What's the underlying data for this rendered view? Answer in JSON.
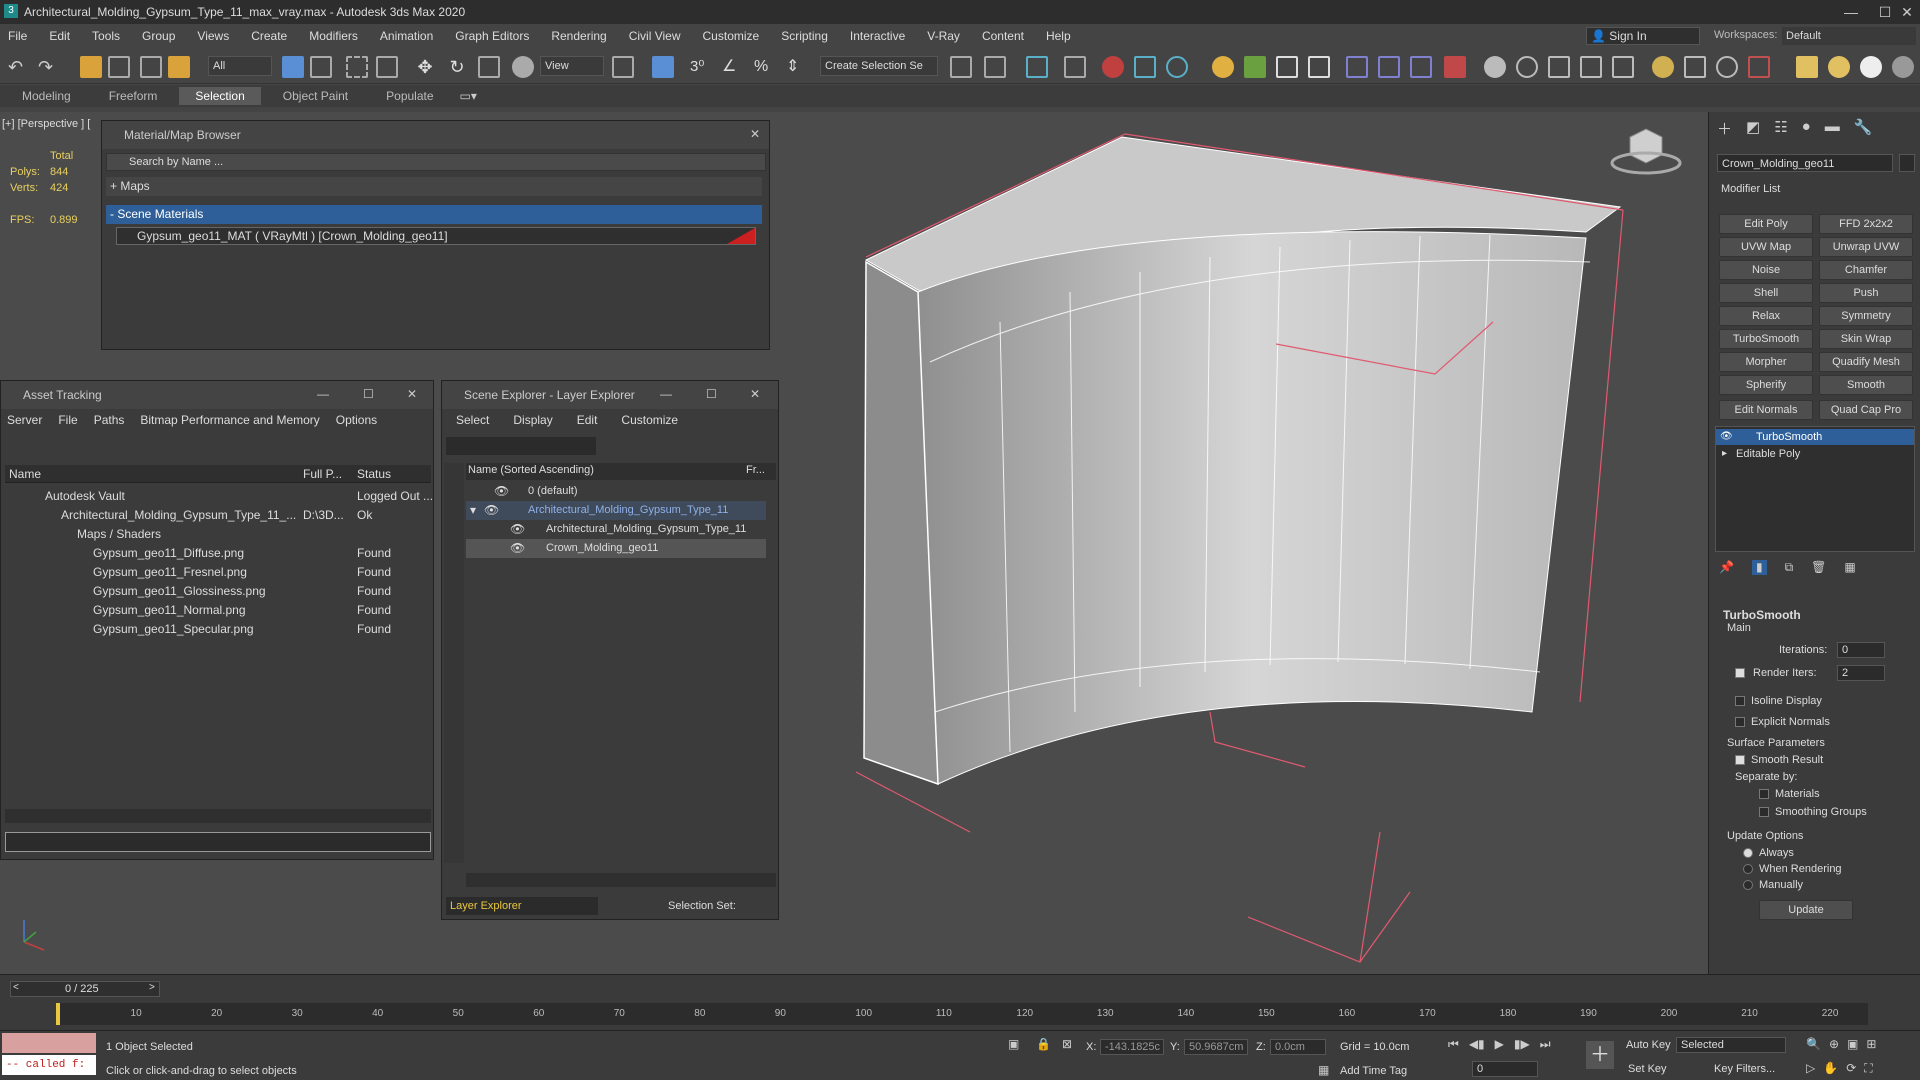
{
  "window": {
    "title": "Architectural_Molding_Gypsum_Type_11_max_vray.max - Autodesk 3ds Max 2020",
    "minimize": "—",
    "maximize": "☐",
    "close": "✕"
  },
  "menu": [
    "File",
    "Edit",
    "Tools",
    "Group",
    "Views",
    "Create",
    "Modifiers",
    "Animation",
    "Graph Editors",
    "Rendering",
    "Civil View",
    "Customize",
    "Scripting",
    "Interactive",
    "V-Ray",
    "Content",
    "Help"
  ],
  "signin": "Sign In",
  "workspaces": {
    "label": "Workspaces:",
    "value": "Default"
  },
  "toolbar": {
    "filter": "All",
    "view": "View",
    "selection_set": "Create Selection Se"
  },
  "ribbon": [
    "Modeling",
    "Freeform",
    "Selection",
    "Object Paint",
    "Populate"
  ],
  "viewport": {
    "label": "[+] [Perspective ] [",
    "stats": {
      "total": "Total",
      "polys_label": "Polys:",
      "polys": "844",
      "verts_label": "Verts:",
      "verts": "424",
      "fps_label": "FPS:",
      "fps": "0.899"
    }
  },
  "material_browser": {
    "title": "Material/Map Browser",
    "search": "Search by Name ...",
    "maps": "+ Maps",
    "scene_materials": "- Scene Materials",
    "item": "Gypsum_geo11_MAT ( VRayMtl ) [Crown_Molding_geo11]"
  },
  "asset_tracking": {
    "title": "Asset Tracking",
    "menu": [
      "Server",
      "File",
      "Paths",
      "Bitmap Performance and Memory",
      "Options"
    ],
    "columns": [
      "Name",
      "Full P...",
      "Status"
    ],
    "rows": [
      {
        "name": "Autodesk Vault",
        "path": "",
        "status": "Logged Out ..."
      },
      {
        "name": "Architectural_Molding_Gypsum_Type_11_...",
        "path": "D:\\3D...",
        "status": "Ok"
      },
      {
        "name": "Maps / Shaders",
        "path": "",
        "status": ""
      },
      {
        "name": "Gypsum_geo11_Diffuse.png",
        "path": "",
        "status": "Found"
      },
      {
        "name": "Gypsum_geo11_Fresnel.png",
        "path": "",
        "status": "Found"
      },
      {
        "name": "Gypsum_geo11_Glossiness.png",
        "path": "",
        "status": "Found"
      },
      {
        "name": "Gypsum_geo11_Normal.png",
        "path": "",
        "status": "Found"
      },
      {
        "name": "Gypsum_geo11_Specular.png",
        "path": "",
        "status": "Found"
      }
    ]
  },
  "scene_explorer": {
    "title": "Scene Explorer - Layer Explorer",
    "menu": [
      "Select",
      "Display",
      "Edit",
      "Customize"
    ],
    "col_name": "Name (Sorted Ascending)",
    "col_fr": "Fr...",
    "rows": [
      "0 (default)",
      "Architectural_Molding_Gypsum_Type_11",
      "Architectural_Molding_Gypsum_Type_11",
      "Crown_Molding_geo11"
    ],
    "footer_mode": "Layer Explorer",
    "footer_sel": "Selection Set:"
  },
  "command_panel": {
    "object_name": "Crown_Molding_geo11",
    "modifier_list": "Modifier List",
    "buttons": [
      "Edit Poly",
      "FFD 2x2x2",
      "UVW Map",
      "Unwrap UVW",
      "Noise",
      "Chamfer",
      "Shell",
      "Push",
      "Relax",
      "Symmetry",
      "TurboSmooth",
      "Skin Wrap",
      "Morpher",
      "Quadify Mesh",
      "Spherify",
      "Smooth",
      "Edit Normals",
      "Quad Cap Pro"
    ],
    "stack": [
      "TurboSmooth",
      "Editable Poly"
    ],
    "rollout": {
      "title": "TurboSmooth",
      "main": "Main",
      "iterations_label": "Iterations:",
      "iterations": "0",
      "render_iters_label": "Render Iters:",
      "render_iters": "2",
      "isoline": "Isoline Display",
      "explicit": "Explicit Normals",
      "surface": "Surface Parameters",
      "smooth_result": "Smooth Result",
      "separate_by": "Separate by:",
      "materials": "Materials",
      "smoothing_groups": "Smoothing Groups",
      "update_options": "Update Options",
      "always": "Always",
      "when_rendering": "When Rendering",
      "manually": "Manually",
      "update": "Update"
    }
  },
  "timeline": {
    "frame": "0 / 225",
    "ticks": [
      "10",
      "20",
      "30",
      "40",
      "50",
      "60",
      "70",
      "80",
      "90",
      "100",
      "110",
      "120",
      "130",
      "140",
      "150",
      "160",
      "170",
      "180",
      "190",
      "200",
      "210",
      "220"
    ]
  },
  "status": {
    "script": "-- called f:",
    "selected": "1 Object Selected",
    "hint": "Click or click-and-drag to select objects",
    "x_label": "X:",
    "x": "-143.1825c",
    "y_label": "Y:",
    "y": "50.9687cm",
    "z_label": "Z:",
    "z": "0.0cm",
    "grid": "Grid = 10.0cm",
    "add_time_tag": "Add Time Tag",
    "auto_key": "Auto Key",
    "set_key": "Set Key",
    "selected_dd": "Selected",
    "key_filters": "Key Filters...",
    "frame_field": "0"
  }
}
